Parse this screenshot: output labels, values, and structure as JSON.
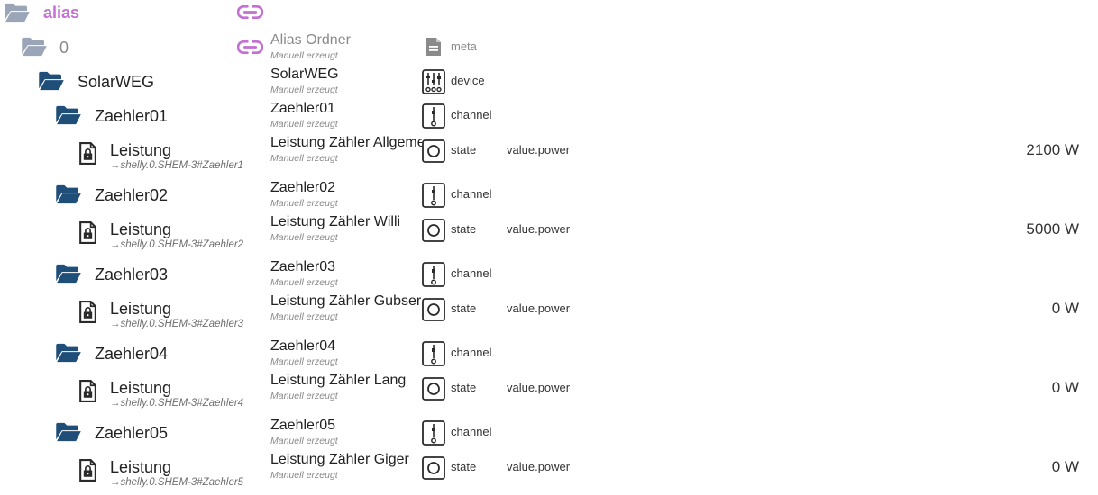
{
  "colors": {
    "folder_closed": "#1f4e79",
    "folder_open_muted": "#9aa6b8",
    "alias_accent": "#c36fd3",
    "type_icon": "#2a2a2a",
    "muted_text": "#8a8a8a"
  },
  "tree": {
    "root": {
      "label": "alias",
      "icon": "folder-open-icon",
      "link_icon": "link-icon"
    },
    "node0": {
      "label": "0",
      "icon": "folder-open-icon",
      "link_icon": "link-icon",
      "name": "Alias Ordner",
      "desc": "Manuell erzeugt",
      "type": "meta",
      "type_icon": "meta-file-icon"
    },
    "solar": {
      "label": "SolarWEG",
      "icon": "folder-open-icon",
      "name": "SolarWEG",
      "desc": "Manuell erzeugt",
      "type": "device",
      "type_icon": "device-sliders-icon"
    },
    "meters": [
      {
        "label": "Zaehler01",
        "name": "Zaehler01",
        "desc": "Manuell erzeugt",
        "type": "channel",
        "state": {
          "label": "Leistung",
          "alias": "→shelly.0.SHEM-3#Zaehler1",
          "name": "Leistung Zähler Allgemein",
          "desc": "Manuell erzeugt",
          "type": "state",
          "role": "value.power",
          "value": "2100 W"
        }
      },
      {
        "label": "Zaehler02",
        "name": "Zaehler02",
        "desc": "Manuell erzeugt",
        "type": "channel",
        "state": {
          "label": "Leistung",
          "alias": "→shelly.0.SHEM-3#Zaehler2",
          "name": "Leistung Zähler Willi",
          "desc": "Manuell erzeugt",
          "type": "state",
          "role": "value.power",
          "value": "5000 W"
        }
      },
      {
        "label": "Zaehler03",
        "name": "Zaehler03",
        "desc": "Manuell erzeugt",
        "type": "channel",
        "state": {
          "label": "Leistung",
          "alias": "→shelly.0.SHEM-3#Zaehler3",
          "name": "Leistung Zähler Gubser",
          "desc": "Manuell erzeugt",
          "type": "state",
          "role": "value.power",
          "value": "0 W"
        }
      },
      {
        "label": "Zaehler04",
        "name": "Zaehler04",
        "desc": "Manuell erzeugt",
        "type": "channel",
        "state": {
          "label": "Leistung",
          "alias": "→shelly.0.SHEM-3#Zaehler4",
          "name": "Leistung Zähler Lang",
          "desc": "Manuell erzeugt",
          "type": "state",
          "role": "value.power",
          "value": "0 W"
        }
      },
      {
        "label": "Zaehler05",
        "name": "Zaehler05",
        "desc": "Manuell erzeugt",
        "type": "channel",
        "state": {
          "label": "Leistung",
          "alias": "→shelly.0.SHEM-3#Zaehler5",
          "name": "Leistung Zähler Giger",
          "desc": "Manuell erzeugt",
          "type": "state",
          "role": "value.power",
          "value": "0 W"
        }
      }
    ]
  }
}
